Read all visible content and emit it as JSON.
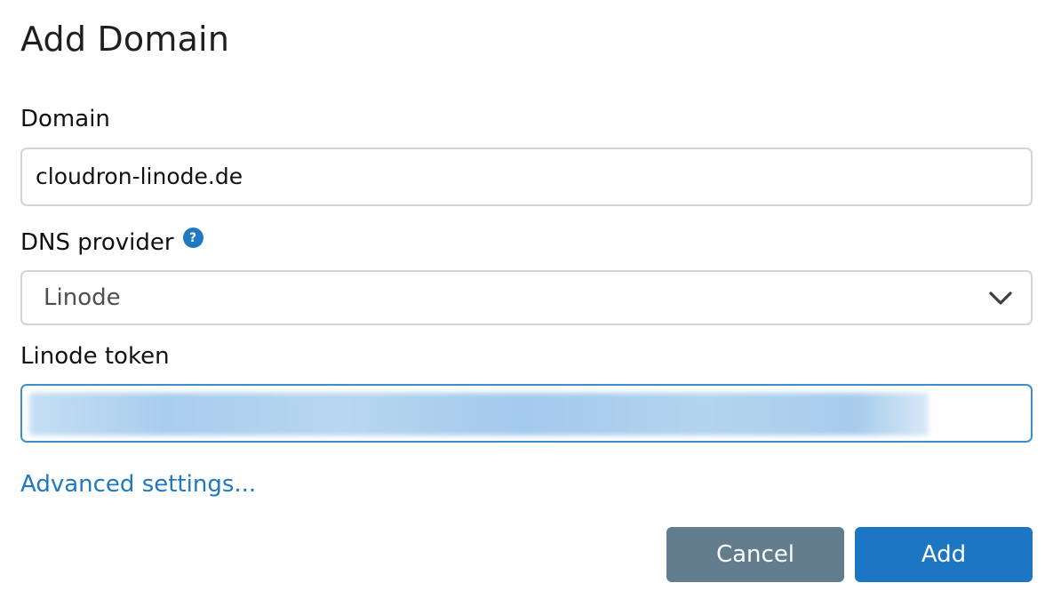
{
  "dialog": {
    "title": "Add Domain"
  },
  "form": {
    "domain_label": "Domain",
    "domain_value": "cloudron-linode.de",
    "dns_label": "DNS provider",
    "dns_help_icon": "?",
    "dns_selected": "Linode",
    "token_label": "Linode token",
    "token_value_redacted": true,
    "advanced_link": "Advanced settings..."
  },
  "actions": {
    "cancel_label": "Cancel",
    "add_label": "Add"
  },
  "colors": {
    "accent": "#1e78c2",
    "cancel_bg": "#637d8f",
    "add_bg": "#1c76c4",
    "focus_border": "#3b8fd1"
  }
}
